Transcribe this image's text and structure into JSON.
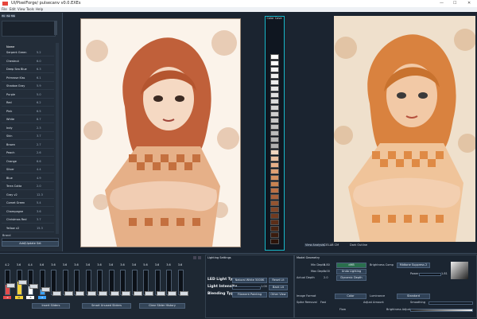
{
  "window": {
    "title": "UI/PixelForge/ pulsecanv v0.0.EXEs",
    "controls": [
      "—",
      "☐",
      "✕"
    ]
  },
  "menu": [
    "File",
    "Edit",
    "View",
    "Tools",
    "Help"
  ],
  "left_panel": {
    "tabs": [
      "Pic",
      "Pal",
      "Mix"
    ],
    "header_name": "Name",
    "rows": [
      {
        "name": "Serpent Green",
        "value": "5.2"
      },
      {
        "name": "Chestnut",
        "value": "6.0"
      },
      {
        "name": "Deep Sea Blue",
        "value": "6.3"
      },
      {
        "name": "Primrose Kiss",
        "value": "6.1"
      },
      {
        "name": "Shadow Gray",
        "value": "5.9"
      },
      {
        "name": "Purple",
        "value": "5.0"
      },
      {
        "name": "Red",
        "value": "6.2"
      },
      {
        "name": "Pink",
        "value": "6.5"
      },
      {
        "name": "White",
        "value": "8.7"
      },
      {
        "name": "Indy",
        "value": "2.3"
      },
      {
        "name": "Skin",
        "value": "3.7"
      },
      {
        "name": "Brown",
        "value": "2.7"
      },
      {
        "name": "Peach",
        "value": "2.6"
      },
      {
        "name": "Orange",
        "value": "6.6"
      },
      {
        "name": "Silver",
        "value": "4.4"
      },
      {
        "name": "Blue",
        "value": "4.9"
      },
      {
        "name": "Terra Cotta",
        "value": "2.0"
      },
      {
        "name": "Gray v2",
        "value": "12.3"
      },
      {
        "name": "Comet Green",
        "value": "5.4"
      },
      {
        "name": "Champagne",
        "value": "3.6"
      },
      {
        "name": "Christmas Red",
        "value": "3.7"
      },
      {
        "name": "Yellow v2",
        "value": "15.3"
      }
    ],
    "brand_label": "Brand",
    "add_update": "Add/Update Set"
  },
  "color_cave": {
    "label": "Color Cave"
  },
  "view_controls": {
    "analysis": "View Analysis",
    "cielab": "CIELAB CM",
    "dark_outline": "Dark Outline"
  },
  "sliders": {
    "values": [
      "4.2",
      "3.6",
      "4.4",
      "0.6",
      "3.6",
      "3.6",
      "3.6",
      "3.6",
      "3.6",
      "3.6",
      "3.6",
      "3.6",
      "5.6",
      "3.6",
      "3.6",
      "3.6"
    ],
    "fills": [
      0.4,
      0.55,
      0.35,
      0.2,
      0.0,
      0.0,
      0.0,
      0.0,
      0.0,
      0.0,
      0.0,
      0.0,
      0.0,
      0.0,
      0.0,
      0.0
    ],
    "fill_colors": [
      "#e54b4b",
      "#f3d23a",
      "#ffffff",
      "#3aa3ff"
    ],
    "badges": [
      "-9",
      "-6",
      "-5",
      "-3"
    ],
    "insert_sliders": "Insert Sliders",
    "smart_unused": "Smart Unused Sliders",
    "clear_history": "Clear Slider History"
  },
  "lighting": {
    "title": "Lighting Settings",
    "light_type_label": "LED Light Type",
    "light_type_value": "Natural White 5000K",
    "light_intensity_label": "Light Intensity",
    "intensity_value": "1.00",
    "blending_label": "Blending Type",
    "blending_value": "Filament Painting",
    "btn_reset": "Reset Lit",
    "btn_back": "Back Lit",
    "btn_other": "Other View"
  },
  "model_geometry": {
    "title": "Model Geometry",
    "min_depth_label": "Min Depth",
    "min_depth": "0.80",
    "max_depth_label": "Max Depth",
    "max_depth": "1.00",
    "actual_depth_label": "Actual Depth",
    "actual_depth": "2.0",
    "btn_depth": "Undo Depth",
    "btn_lighting": "Undo Lighting",
    "btn_dynamic": "Dynamic Depth",
    "btn_green": "dHB",
    "brightness_comp_label": "Brightness Comp",
    "brightness_comp_value": "Midtone Suppress 2",
    "power_label": "Power",
    "power_value": "1.81",
    "image_format_label": "Image Format",
    "image_format": "Color",
    "luminance_label": "Luminance",
    "luminance": "Standard",
    "spike_label": "Spike Removal",
    "spike_value": "Fast",
    "adjust_label": "Adjust Amount",
    "smoothing_label": "Smoothing",
    "flow_label": "Flow",
    "brightness_adjust_label": "Brightness Adjust"
  }
}
